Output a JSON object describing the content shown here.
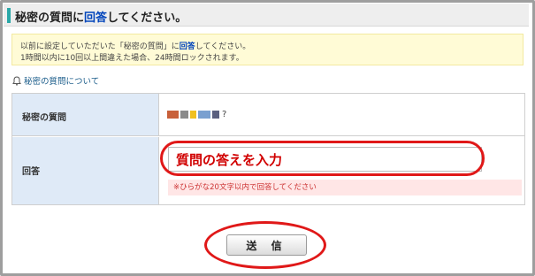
{
  "header": {
    "title_before": "秘密の質問に",
    "title_highlight": "回答",
    "title_after": "してください。"
  },
  "notice": {
    "line1_before": "以前に設定していただいた「秘密の質問」に",
    "line1_highlight": "回答",
    "line1_after": "してください。",
    "line2": "1時間以内に10回以上間違えた場合、24時間ロックされます。"
  },
  "about_link": "秘密の質問について",
  "form": {
    "question_label": "秘密の質問",
    "question_mark": "?",
    "question_blocks": [
      "#c8603a",
      "#8a8a8a",
      "#f0c020",
      "#7aa0d0",
      "#5a6080"
    ],
    "answer_label": "回答",
    "answer_value": "質問の答えを入力",
    "answer_note": "※ひらがな20文字以内で回答してください"
  },
  "submit_label": "送 信",
  "colors": {
    "accent_bar": "#2aa8a8",
    "highlight_text": "#0044bb",
    "annotation_red": "#e01818",
    "label_bg": "#dfeaf7",
    "notice_bg": "#fffbd6"
  }
}
